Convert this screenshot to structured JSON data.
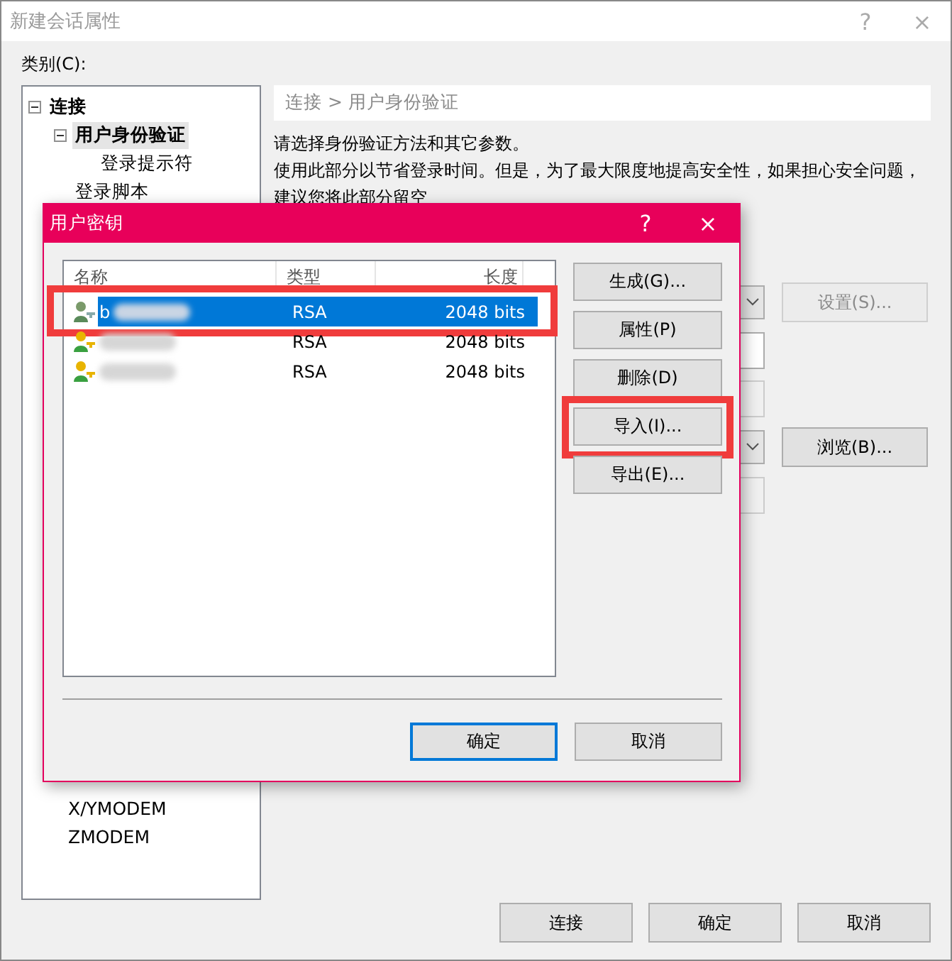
{
  "window": {
    "title": "新建会话属性",
    "help": "?",
    "close": "×"
  },
  "category_label": "类别(C):",
  "tree": {
    "top": [
      {
        "label": "连接",
        "bold": true,
        "expanded": true,
        "selected": false,
        "children": [
          {
            "label": "用户身份验证",
            "bold": true,
            "expanded": true,
            "selected": true,
            "children": [
              {
                "label": "登录提示符",
                "bold": false,
                "selected": false
              }
            ]
          },
          {
            "label": "登录脚本",
            "bold": false,
            "selected": false
          }
        ]
      }
    ],
    "bottom": [
      {
        "label": "X/YMODEM",
        "selected": false
      },
      {
        "label": "ZMODEM",
        "selected": false
      }
    ]
  },
  "breadcrumb": "连接 > 用户身份验证",
  "paragraphs": [
    "请选择身份验证方法和其它参数。",
    "使用此部分以节省登录时间。但是，为了最大限度地提高安全性，如果担心安全问题，",
    "建议您将此部分留空"
  ],
  "side_controls": [
    {
      "kind": "dropdown",
      "button": "设置(S)...",
      "disabled": true
    },
    {
      "kind": "field",
      "disabled": false
    },
    {
      "kind": "field",
      "disabled": true
    },
    {
      "kind": "dropdown",
      "button": "浏览(B)...",
      "disabled": false
    },
    {
      "kind": "field",
      "disabled": true
    }
  ],
  "buttons": [
    "连接",
    "确定",
    "取消"
  ],
  "dialog": {
    "title": "用户密钥",
    "help": "?",
    "close": "×",
    "columns": [
      "名称",
      "类型",
      "长度"
    ],
    "rows": [
      {
        "name": "b",
        "type": "RSA",
        "length": "2048 bits",
        "selected": true,
        "highlighted": true,
        "redacted": true
      },
      {
        "type": "RSA",
        "length": "2048 bits",
        "selected": false,
        "redacted": true
      },
      {
        "type": "RSA",
        "length": "2048 bits",
        "selected": false,
        "redacted": true
      }
    ],
    "side_buttons": [
      {
        "label": "生成(G)..."
      },
      {
        "label": "属性(P)"
      },
      {
        "label": "删除(D)"
      },
      {
        "label": "导入(I)...",
        "highlighted": true
      },
      {
        "label": "导出(E)..."
      }
    ],
    "buttons": [
      {
        "label": "确定",
        "default": true
      },
      {
        "label": "取消",
        "default": false
      }
    ]
  }
}
